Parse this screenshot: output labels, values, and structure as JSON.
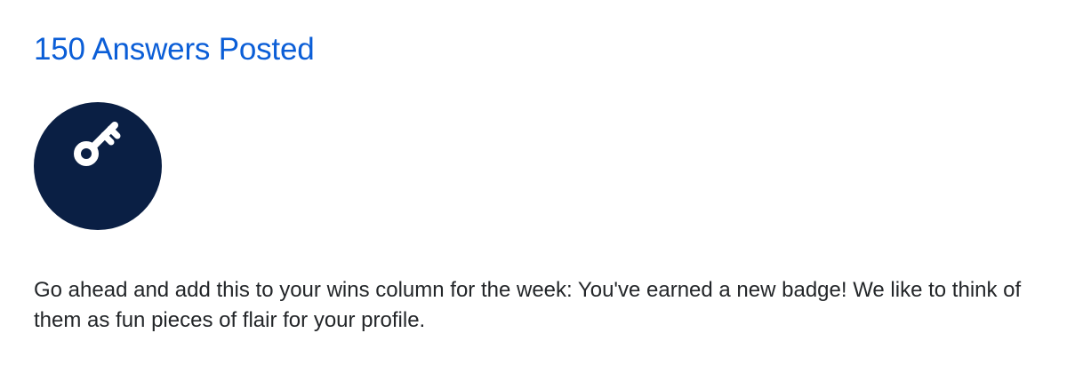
{
  "badge": {
    "title": "150 Answers Posted",
    "icon": "key-icon",
    "count": "150",
    "description": "Go ahead and add this to your wins column for the week: You've earned a new badge! We like to think of them as fun pieces of flair for your profile."
  },
  "colors": {
    "title": "#0b5ed7",
    "badge_background": "#0a1f44",
    "badge_foreground": "#ffffff",
    "body_text": "#232629"
  }
}
